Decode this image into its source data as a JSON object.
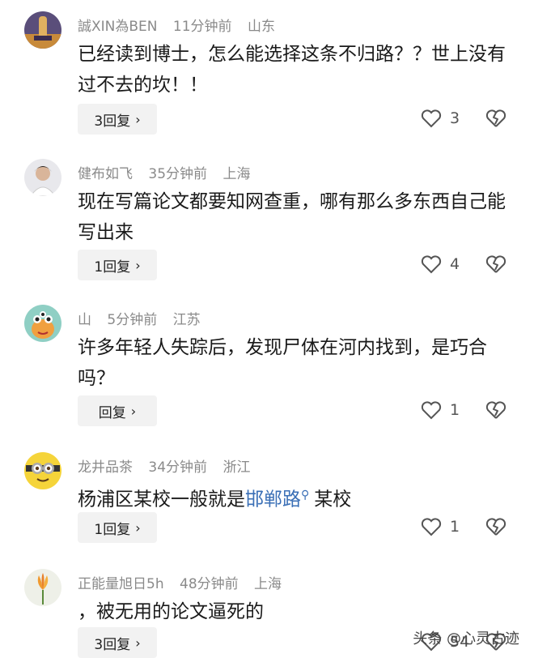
{
  "comments": [
    {
      "username": "誠XIN為BEN",
      "time": "11分钟前",
      "location": "山东",
      "text": "已经读到博士，怎么能选择这条不归路？？世上没有过不去的坎！！",
      "reply_label": "3回复",
      "likes": "3",
      "avatar_icon": "building-icon"
    },
    {
      "username": "健布如飞",
      "time": "35分钟前",
      "location": "上海",
      "text": "现在写篇论文都要知网查重，哪有那么多东西自己能写出来",
      "reply_label": "1回复",
      "likes": "4",
      "avatar_icon": "person-icon"
    },
    {
      "username": "山",
      "time": "5分钟前",
      "location": "江苏",
      "text": "许多年轻人失踪后，发现尸体在河内找到，是巧合吗？",
      "reply_label": "回复",
      "likes": "1",
      "avatar_icon": "monster-icon"
    },
    {
      "username": "龙井品茶",
      "time": "34分钟前",
      "location": "浙江",
      "text_before": "杨浦区某校一般就是",
      "text_link": "邯郸路",
      "text_after": "某校",
      "reply_label": "1回复",
      "likes": "1",
      "avatar_icon": "minion-icon"
    },
    {
      "username": "正能量旭日5h",
      "time": "48分钟前",
      "location": "上海",
      "text": "，被无用的论文逼死的",
      "reply_label": "3回复",
      "likes": "54",
      "avatar_icon": "flower-icon"
    }
  ],
  "watermark": "头条 @心灵古迹",
  "colors": {
    "link": "#3a6fb6",
    "meta": "#8a8a8a",
    "reply_bg": "#f2f2f2"
  }
}
